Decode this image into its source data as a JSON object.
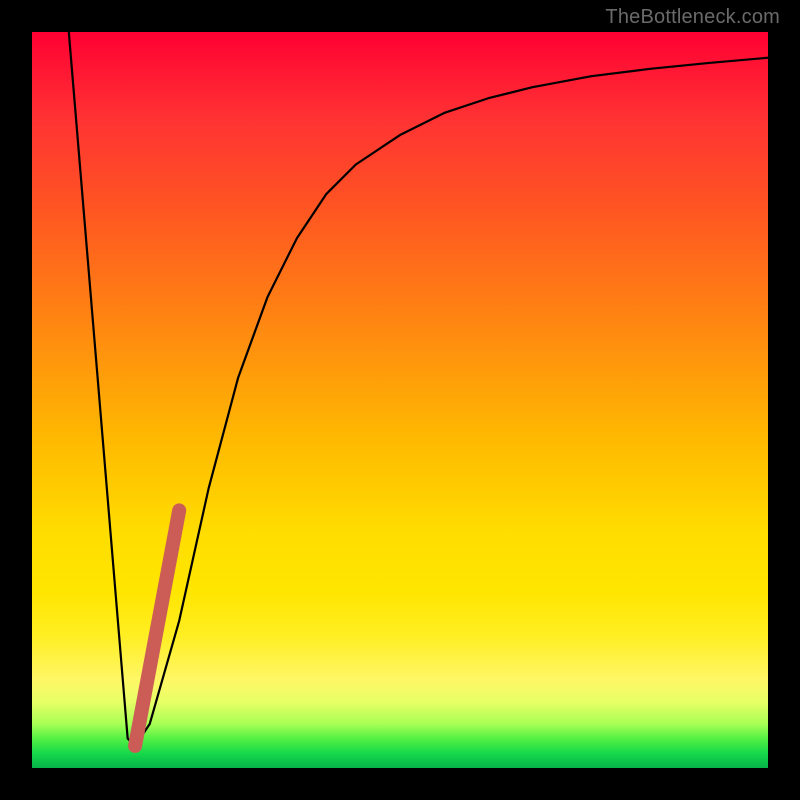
{
  "watermark": "TheBottleneck.com",
  "chart_data": {
    "type": "line",
    "title": "",
    "xlabel": "",
    "ylabel": "",
    "ylim": [
      0,
      100
    ],
    "xlim": [
      0,
      100
    ],
    "series": [
      {
        "name": "curve",
        "x": [
          5,
          13,
          14,
          16,
          20,
          24,
          28,
          32,
          36,
          40,
          44,
          50,
          56,
          62,
          68,
          76,
          84,
          92,
          100
        ],
        "values": [
          100,
          4,
          3,
          6,
          20,
          38,
          53,
          64,
          72,
          78,
          82,
          86,
          89,
          91,
          92.5,
          94,
          95,
          95.8,
          96.5
        ]
      },
      {
        "name": "highlight",
        "x": [
          14,
          20
        ],
        "values": [
          3,
          35
        ]
      }
    ],
    "colors": {
      "curve": "#000000",
      "highlight": "#cc5d56"
    }
  }
}
